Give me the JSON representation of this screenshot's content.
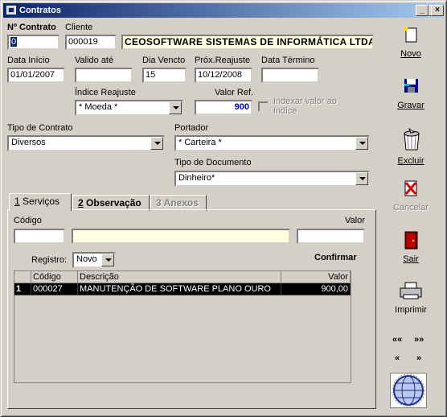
{
  "window": {
    "title": "Contratos",
    "min": "_",
    "max": "□",
    "close": "×"
  },
  "form": {
    "num_contrato_label": "Nº Contrato",
    "num_contrato": "0",
    "cliente_label": "Cliente",
    "cliente_code": "000019",
    "cliente_name": "CEOSOFTWARE SISTEMAS DE INFORMÁTICA LTDA",
    "data_inicio_label": "Data Início",
    "data_inicio": "01/01/2007",
    "valido_ate_label": "Valido até",
    "valido_ate": "",
    "dia_vencto_label": "Dia Vencto",
    "dia_vencto": "15",
    "prox_reajuste_label": "Próx.Reajuste",
    "prox_reajuste": "10/12/2008",
    "data_termino_label": "Data Término",
    "data_termino": "",
    "indice_label": "Índice Reajuste",
    "indice": "* Moeda *",
    "valor_ref_label": "Valor Ref.",
    "valor_ref": "900",
    "indexar_label": "Indexar valor ao índice",
    "tipo_contrato_label": "Tipo de Contrato",
    "tipo_contrato": "Diversos",
    "portador_label": "Portador",
    "portador": "* Carteira *",
    "tipo_documento_label": "Tipo de Documento",
    "tipo_documento": "Dinheiro*"
  },
  "tabs": [
    {
      "num": "1",
      "label": "Serviços"
    },
    {
      "num": "2",
      "label": "Observação"
    },
    {
      "num": "3",
      "label": "Anexos"
    }
  ],
  "servicos": {
    "codigo_label": "Código",
    "valor_label": "Valor",
    "registro_label": "Registro:",
    "registro": "Novo",
    "confirmar": "Confirmar",
    "columns": [
      "Código",
      "Descrição",
      "Valor"
    ],
    "rows": [
      {
        "n": "1",
        "codigo": "000027",
        "descricao": "MANUTENÇÃO DE SOFTWARE PLANO OURO",
        "valor": "900,00"
      }
    ]
  },
  "toolbar": {
    "novo": "Novo",
    "gravar": "Gravar",
    "excluir": "Excluir",
    "cancelar": "Cancelar",
    "sair": "Sair",
    "imprimir": "Imprimir",
    "first": "««",
    "last": "»»",
    "prev": "«",
    "next": "»"
  }
}
